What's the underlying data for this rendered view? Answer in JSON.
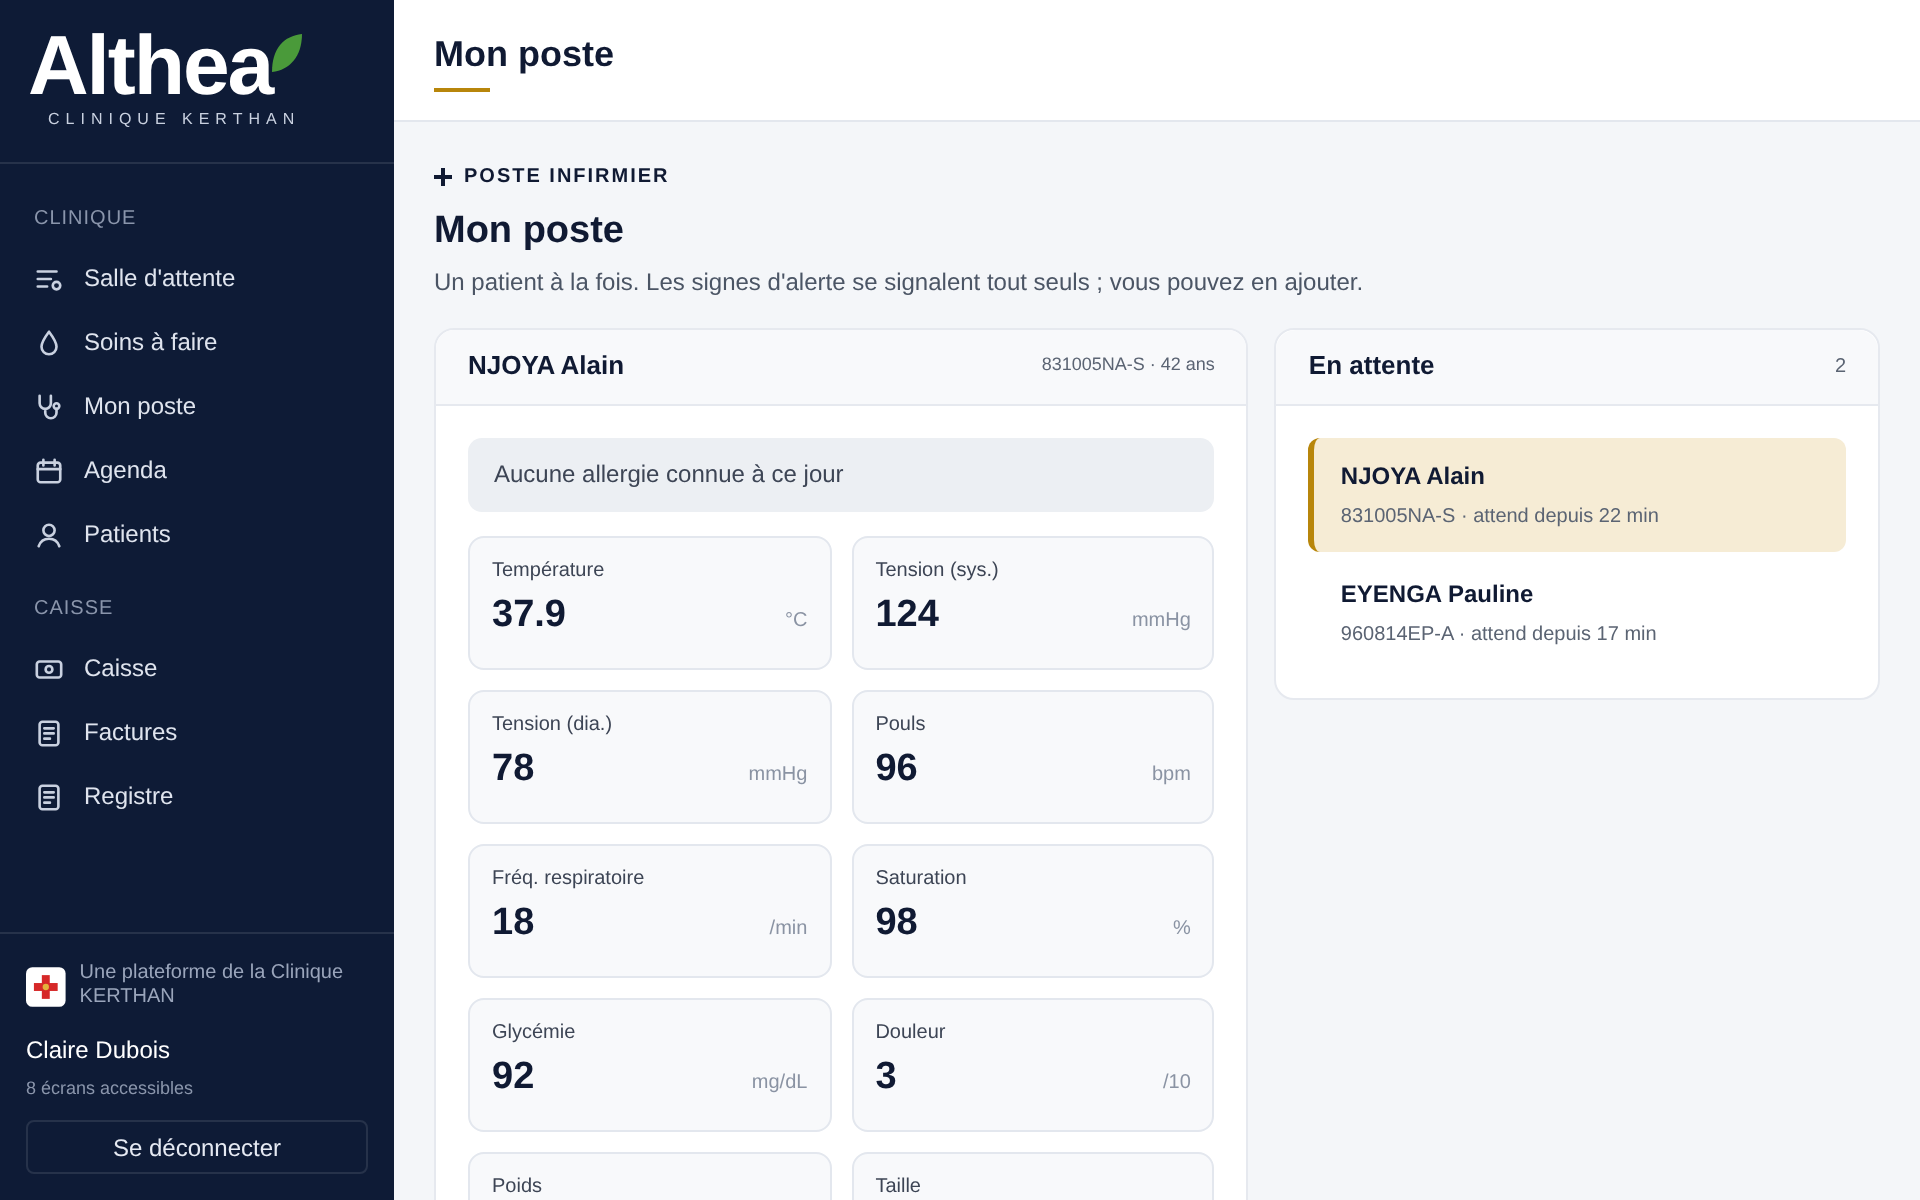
{
  "sidebar": {
    "logo": {
      "name": "Althea",
      "subtitle": "CLINIQUE KERTHAN"
    },
    "sections": [
      {
        "title": "CLINIQUE",
        "items": [
          {
            "label": "Salle d'attente",
            "selected": false
          },
          {
            "label": "Soins à faire",
            "selected": false
          },
          {
            "label": "Mon poste",
            "selected": false
          },
          {
            "label": "Agenda",
            "selected": false
          },
          {
            "label": "Patients",
            "selected": false
          }
        ]
      },
      {
        "title": "CAISSE",
        "items": [
          {
            "label": "Caisse",
            "selected": false
          },
          {
            "label": "Factures",
            "selected": false
          },
          {
            "label": "Registre",
            "selected": false
          }
        ]
      }
    ],
    "footer": {
      "platform": "Une plateforme de la Clinique KERTHAN",
      "user": "Claire Dubois",
      "access": "8 écrans accessibles",
      "logout": "Se déconnecter"
    }
  },
  "header": {
    "title": "Mon poste"
  },
  "page": {
    "eyebrow": "POSTE INFIRMIER",
    "title": "Mon poste",
    "description": "Un patient à la fois. Les signes d'alerte se signalent tout seuls ; vous pouvez en ajouter."
  },
  "patient_card": {
    "name": "NJOYA Alain",
    "meta": "831005NA-S · 42 ans",
    "allergy": "Aucune allergie connue à ce jour",
    "vitals": [
      {
        "label": "Température",
        "value": "37.9",
        "unit": "°C"
      },
      {
        "label": "Tension (sys.)",
        "value": "124",
        "unit": "mmHg"
      },
      {
        "label": "Tension (dia.)",
        "value": "78",
        "unit": "mmHg"
      },
      {
        "label": "Pouls",
        "value": "96",
        "unit": "bpm"
      },
      {
        "label": "Fréq. respiratoire",
        "value": "18",
        "unit": "/min"
      },
      {
        "label": "Saturation",
        "value": "98",
        "unit": "%"
      },
      {
        "label": "Glycémie",
        "value": "92",
        "unit": "mg/dL"
      },
      {
        "label": "Douleur",
        "value": "3",
        "unit": "/10"
      },
      {
        "label": "Poids"
      },
      {
        "label": "Taille"
      }
    ]
  },
  "queue": {
    "title": "En attente",
    "count": "2",
    "patients": [
      {
        "name": "NJOYA Alain",
        "detail": "831005NA-S · attend depuis 22 min",
        "selected": true
      },
      {
        "name": "EYENGA Pauline",
        "detail": "960814EP-A · attend depuis 17 min",
        "selected": false
      }
    ]
  }
}
